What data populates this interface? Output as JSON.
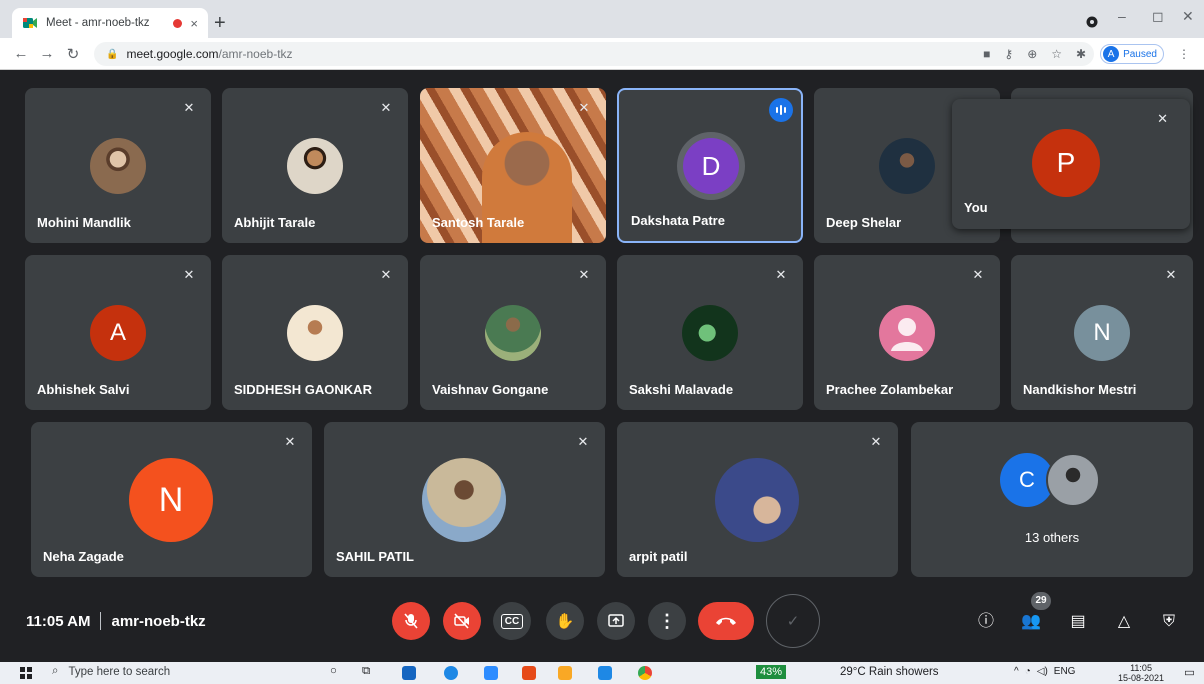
{
  "browser": {
    "tab_title": "Meet - amr-noeb-tkz",
    "tab_close": "×",
    "new_tab": "+",
    "url_host": "meet.google.com",
    "url_path": "/amr-noeb-tkz",
    "profile_initial": "A",
    "profile_status": "Paused",
    "window_controls": [
      "–",
      "◻",
      "✕"
    ]
  },
  "participants_row1": [
    {
      "name": "Mohini Mandlik",
      "avatar": "photo"
    },
    {
      "name": "Abhijit Tarale",
      "avatar": "photo"
    },
    {
      "name": "Santosh Tarale",
      "avatar": "video"
    },
    {
      "name": "Dakshata Patre",
      "avatar": "initial",
      "initial": "D",
      "color": "#7b3fc4",
      "speaking": true
    },
    {
      "name": "Deep Shelar",
      "avatar": "photo"
    }
  ],
  "participants_row2": [
    {
      "name": "Abhishek Salvi",
      "avatar": "initial",
      "initial": "A",
      "color": "#c5310d"
    },
    {
      "name": "SIDDHESH GAONKAR",
      "avatar": "photo"
    },
    {
      "name": "Vaishnav Gongane",
      "avatar": "photo"
    },
    {
      "name": "Sakshi Malavade",
      "avatar": "photo"
    },
    {
      "name": "Prachee Zolambekar",
      "avatar": "generic",
      "color": "#e3779d"
    },
    {
      "name": "Nandkishor Mestri",
      "avatar": "initial",
      "initial": "N",
      "color": "#78909c"
    }
  ],
  "participants_row3": [
    {
      "name": "Neha Zagade",
      "avatar": "initial",
      "initial": "N",
      "color": "#f4511e"
    },
    {
      "name": "SAHIL PATIL",
      "avatar": "photo"
    },
    {
      "name": "arpit patil",
      "avatar": "photo"
    }
  ],
  "self": {
    "label": "You",
    "initial": "P",
    "color": "#c5310d"
  },
  "others": {
    "initial": "C",
    "color": "#1a73e8",
    "label": "13 others"
  },
  "meeting": {
    "time": "11:05 AM",
    "code": "amr-noeb-tkz",
    "participant_count": "29"
  },
  "controls": {
    "mic_icon": "mic-off-icon",
    "camera_icon": "camera-off-icon",
    "captions_label": "CC"
  },
  "taskbar": {
    "search_placeholder": "Type here to search",
    "battery": "43%",
    "weather": "29°C  Rain showers",
    "language": "ENG",
    "time": "11:05",
    "date": "15-08-2021"
  }
}
